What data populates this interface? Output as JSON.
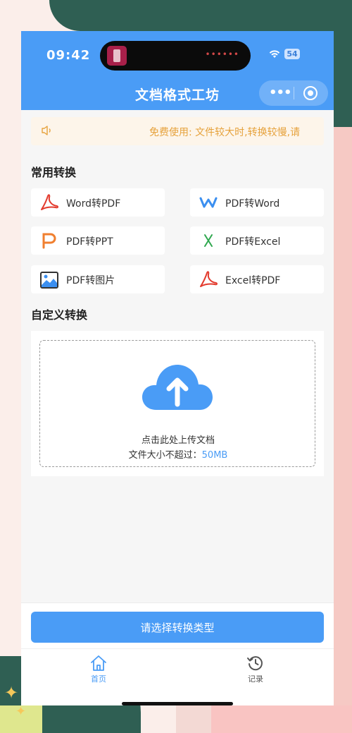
{
  "status_bar": {
    "time": "09:42",
    "battery": "54"
  },
  "app": {
    "title": "文档格式工坊",
    "capsule_more": "•••"
  },
  "notice": {
    "text": "免费使用: 文件较大时,转换较慢,请"
  },
  "sections": {
    "common": "常用转换",
    "custom": "自定义转换"
  },
  "conversions": [
    {
      "label": "Word转PDF",
      "icon": "acrobat-icon",
      "color": "#e33b2e"
    },
    {
      "label": "PDF转Word",
      "icon": "wps-w-icon",
      "color": "#3b8ff0"
    },
    {
      "label": "PDF转PPT",
      "icon": "ppt-p-icon",
      "color": "#f07f2f"
    },
    {
      "label": "PDF转Excel",
      "icon": "excel-x-icon",
      "color": "#2fa84f"
    },
    {
      "label": "PDF转图片",
      "icon": "image-icon",
      "color": "#333333"
    },
    {
      "label": "Excel转PDF",
      "icon": "acrobat-icon",
      "color": "#e33b2e"
    }
  ],
  "upload": {
    "line1": "点击此处上传文档",
    "line2_prefix": "文件大小不超过：",
    "limit": "50MB"
  },
  "bottom": {
    "select_button": "请选择转换类型",
    "tabs": [
      {
        "label": "首页",
        "icon": "home-icon",
        "active": true
      },
      {
        "label": "记录",
        "icon": "history-icon",
        "active": false
      }
    ]
  },
  "colors": {
    "primary": "#4a9cf6",
    "notice": "#e6a23c",
    "page_bg": "#f6f6f6"
  }
}
